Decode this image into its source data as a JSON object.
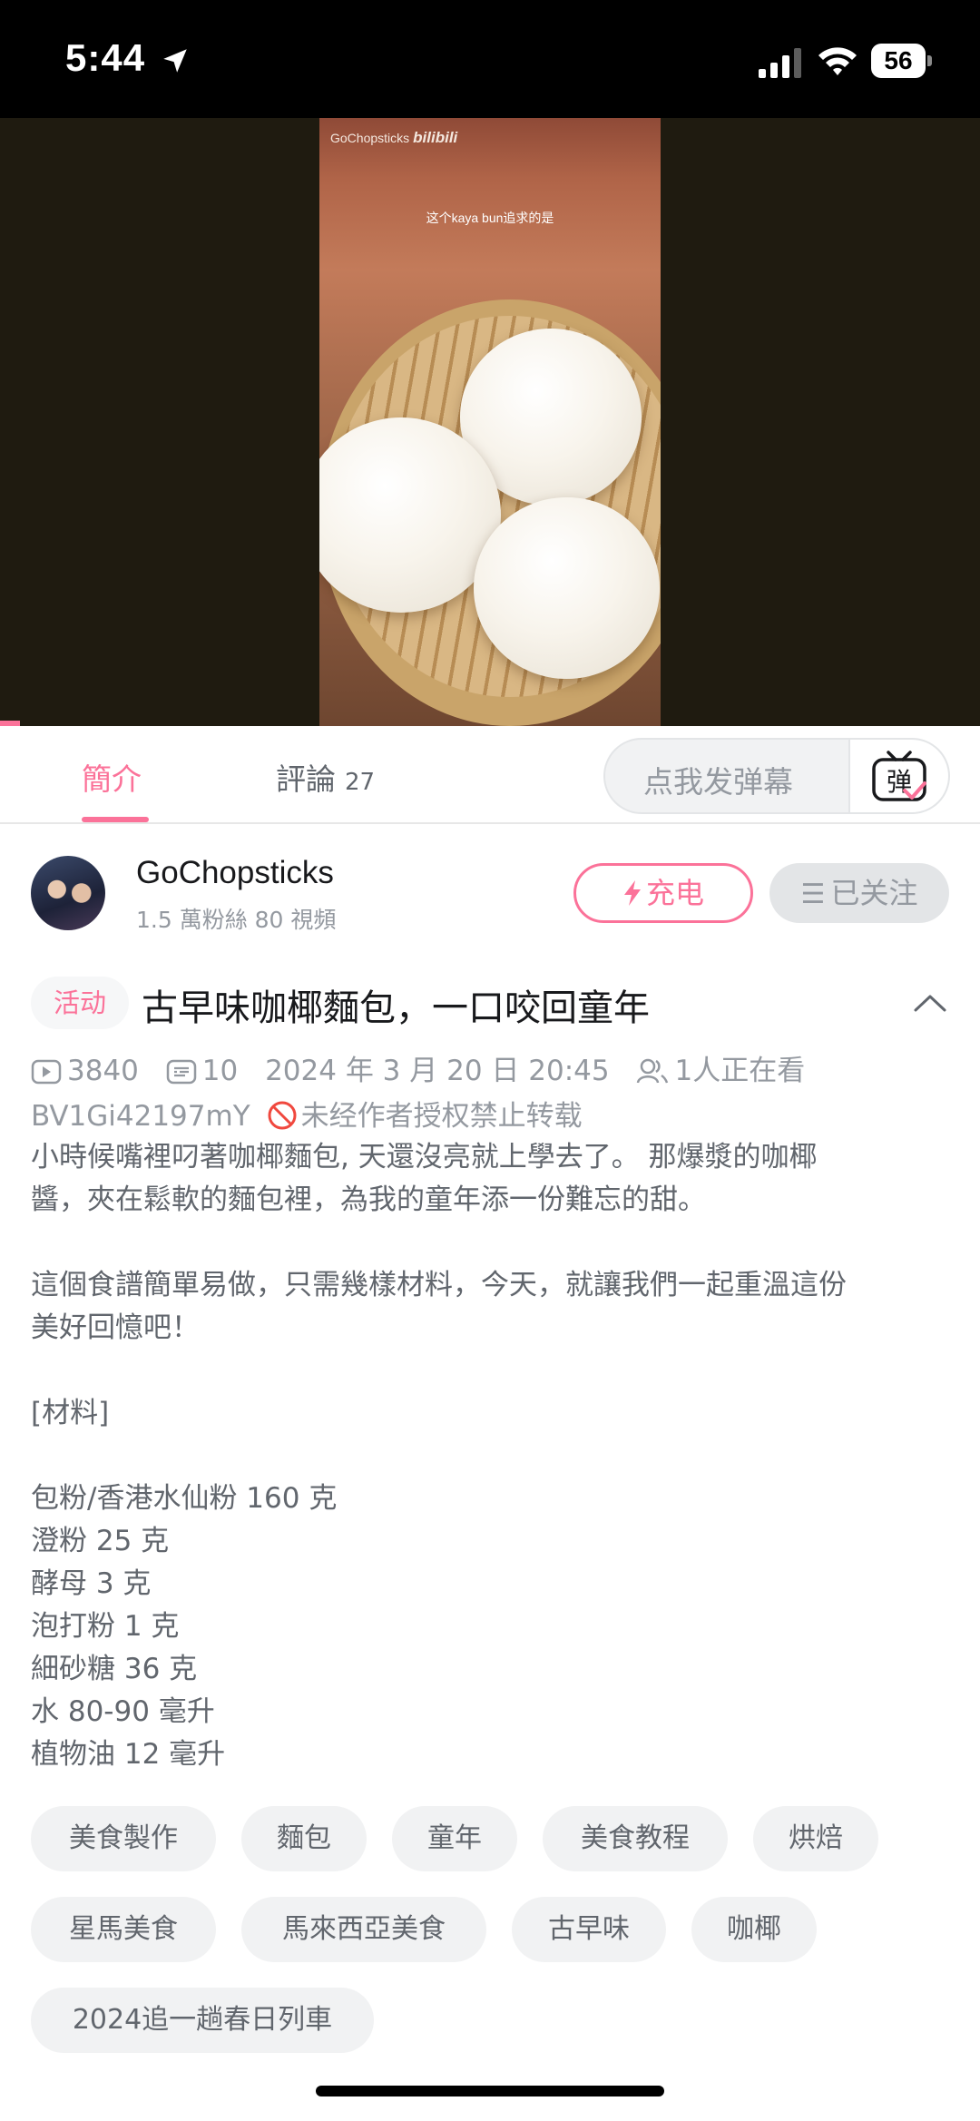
{
  "status_bar": {
    "time": "5:44",
    "battery": "56"
  },
  "video": {
    "watermark_channel": "GoChopsticks",
    "watermark_brand": "bilibili",
    "subtitle": "这个kaya bun追求的是",
    "progress": 0.02
  },
  "tabs": {
    "intro_label": "簡介",
    "comments_label": "評論",
    "comments_count": "27",
    "danmaku_placeholder": "点我发弹幕",
    "danmaku_icon_char": "弹"
  },
  "uploader": {
    "name": "GoChopsticks",
    "meta": "1.5 萬粉絲   80 視頻",
    "charge_label": "充电",
    "follow_label": "已关注"
  },
  "video_info": {
    "activity_tag": "活动",
    "title": "古早味咖椰麵包，一口咬回童年",
    "plays": "3840",
    "danmaku_count": "10",
    "datetime": "2024 年 3 月 20 日  20:45",
    "watching": "1人正在看",
    "bvid": "BV1Gi42197mY",
    "copyright": "未经作者授权禁止转载"
  },
  "description": [
    "小時候嘴裡叼著咖椰麵包, 天還沒亮就上學去了。 那爆漿的咖椰",
    "醬，夾在鬆軟的麵包裡，為我的童年添一份難忘的甜。",
    "",
    "這個食譜簡單易做，只需幾樣材料，今天，就讓我們一起重溫這份",
    "美好回憶吧！",
    "",
    "[材料]",
    "",
    "包粉/香港水仙粉 160 克",
    "澄粉 25 克",
    "酵母 3 克",
    "泡打粉 1 克",
    "細砂糖 36 克",
    "水 80-90 毫升",
    "植物油 12 毫升"
  ],
  "tags": [
    "美食製作",
    "麵包",
    "童年",
    "美食教程",
    "烘焙",
    "星馬美食",
    "馬來西亞美食",
    "古早味",
    "咖椰",
    "2024追一趟春日列車"
  ],
  "colors": {
    "accent": "#fb7299",
    "text_primary": "#18191c",
    "text_secondary": "#61666d",
    "text_muted": "#9499a0"
  }
}
